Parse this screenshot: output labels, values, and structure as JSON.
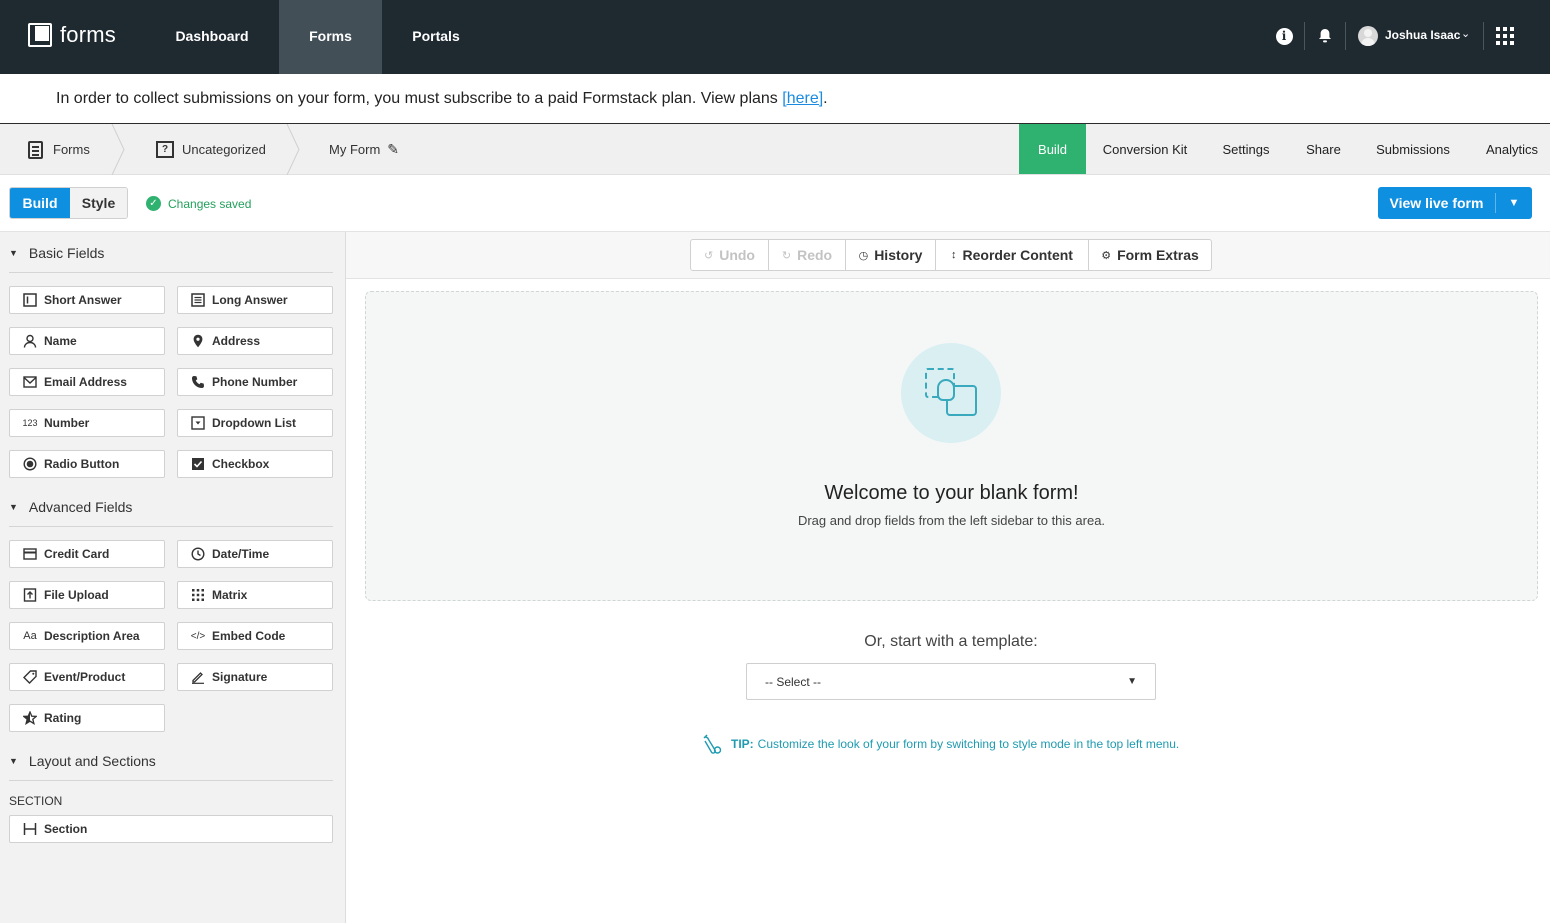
{
  "app": {
    "logo_text": "forms",
    "nav": [
      "Dashboard",
      "Forms",
      "Portals"
    ],
    "user_name": "Joshua Isaac"
  },
  "banner": {
    "text": "In order to collect submissions on your form, you must subscribe to a paid Formstack plan. View plans ",
    "link": "[here]",
    "after": "."
  },
  "breadcrumb": [
    "Forms",
    "Uncategorized",
    "My Form"
  ],
  "folder_glyph": "?",
  "tabs": [
    "Build",
    "Conversion Kit",
    "Settings",
    "Share",
    "Submissions",
    "Analytics"
  ],
  "mode": {
    "build": "Build",
    "style": "Style"
  },
  "status": "Changes saved",
  "view_live": "View live form",
  "sidebar": {
    "basic_title": "Basic Fields",
    "basic": [
      {
        "label": "Short Answer",
        "icon": "short-answer-icon"
      },
      {
        "label": "Long Answer",
        "icon": "long-answer-icon"
      },
      {
        "label": "Name",
        "icon": "person-icon"
      },
      {
        "label": "Address",
        "icon": "map-pin-icon"
      },
      {
        "label": "Email Address",
        "icon": "envelope-icon"
      },
      {
        "label": "Phone Number",
        "icon": "phone-icon"
      },
      {
        "label": "Number",
        "icon": "number-icon",
        "glyph": "123"
      },
      {
        "label": "Dropdown List",
        "icon": "dropdown-icon"
      },
      {
        "label": "Radio Button",
        "icon": "radio-icon"
      },
      {
        "label": "Checkbox",
        "icon": "checkbox-icon"
      }
    ],
    "advanced_title": "Advanced Fields",
    "advanced": [
      {
        "label": "Credit Card",
        "icon": "credit-card-icon"
      },
      {
        "label": "Date/Time",
        "icon": "clock-icon"
      },
      {
        "label": "File Upload",
        "icon": "file-upload-icon"
      },
      {
        "label": "Matrix",
        "icon": "matrix-icon"
      },
      {
        "label": "Description Area",
        "icon": "text-icon",
        "glyph": "Aa"
      },
      {
        "label": "Embed Code",
        "icon": "code-icon",
        "glyph": "</>"
      },
      {
        "label": "Event/Product",
        "icon": "tag-icon"
      },
      {
        "label": "Signature",
        "icon": "pen-icon"
      },
      {
        "label": "Rating",
        "icon": "star-icon"
      }
    ],
    "layout_title": "Layout and Sections",
    "section_label": "SECTION",
    "section_item": "Section"
  },
  "actions": {
    "undo": "Undo",
    "redo": "Redo",
    "history": "History",
    "reorder": "Reorder Content",
    "extras": "Form Extras"
  },
  "blank": {
    "title": "Welcome to your blank form!",
    "subtitle": "Drag and drop fields from the left sidebar to this area."
  },
  "template": {
    "title": "Or, start with a template:",
    "select_value": "-- Select --"
  },
  "tip": {
    "label": "TIP:",
    "text": "Customize the look of your form by switching to style mode in the top left menu."
  },
  "colors": {
    "nav_bg": "#1e2930",
    "accent_blue": "#0f8fe0",
    "build_green": "#2fb26f",
    "tip_teal": "#1f9bb0"
  }
}
